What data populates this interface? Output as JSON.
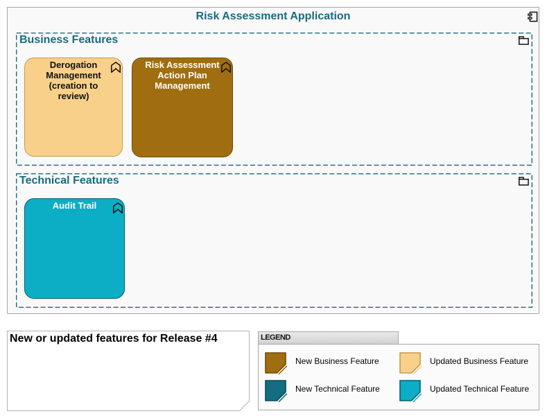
{
  "diagram": {
    "title": "Risk Assessment Application",
    "container_icon": "uml-component-icon",
    "groups": [
      {
        "label": "Business Features",
        "icon": "folder-icon",
        "features": [
          {
            "label": "Derogation Management (creation to review)",
            "status": "Updated Business Feature",
            "fill": "#f8d089",
            "border": "#c69a4e",
            "text_color": "#111111",
            "icon": "chevron-banner-icon"
          },
          {
            "label": "Risk Assessment Action Plan Management",
            "status": "New Business Feature",
            "fill": "#a06e10",
            "border": "#6f4e04",
            "text_color": "#ffffff",
            "icon": "chevron-banner-icon"
          }
        ]
      },
      {
        "label": "Technical Features",
        "icon": "folder-icon",
        "features": [
          {
            "label": "Audit Trail",
            "status": "Updated Technical Feature",
            "fill": "#0caec5",
            "border": "#04606e",
            "text_color": "#ffffff",
            "icon": "chevron-banner-icon"
          }
        ]
      }
    ]
  },
  "note": {
    "text": "New or updated features for Release #4"
  },
  "legend": {
    "title": "LEGEND",
    "items": [
      {
        "label": "New Business Feature",
        "color": "#a06e10",
        "border": "#6f4e04"
      },
      {
        "label": "Updated Business Feature",
        "color": "#f8d089",
        "border": "#c69a4e"
      },
      {
        "label": "New Technical Feature",
        "color": "#136e80",
        "border": "#0a4a56"
      },
      {
        "label": "Updated Technical Feature",
        "color": "#0caec5",
        "border": "#04606e"
      }
    ]
  },
  "colors": {
    "accent_teal": "#176b80",
    "container_fill": "#f9f9f9",
    "container_border": "#a6a6a6",
    "page_background": "#ffffff"
  }
}
